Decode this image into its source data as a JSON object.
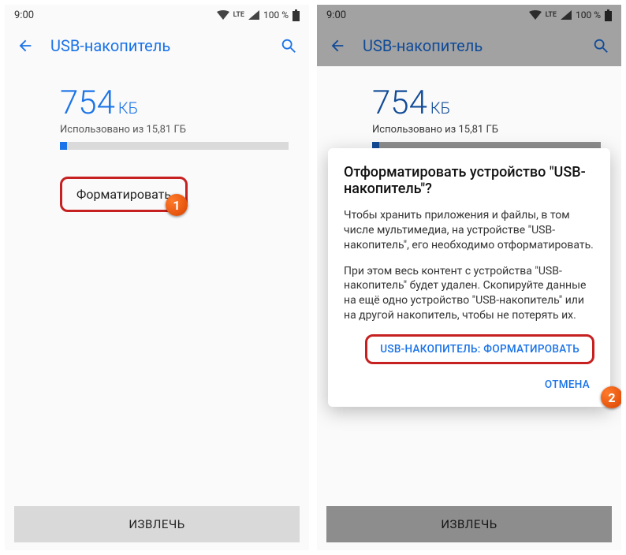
{
  "status": {
    "time": "9:00",
    "battery": "100 %",
    "network": "LTE"
  },
  "appbar": {
    "title": "USB-накопитель"
  },
  "storage": {
    "amount": "754",
    "unit": "КБ",
    "sub": "Использовано из 15,81 ГБ"
  },
  "format_label": "Форматировать",
  "eject_label": "ИЗВЛЕЧЬ",
  "dialog": {
    "title": "Отформатировать устройство \"USB-накопитель\"?",
    "p1": "Чтобы хранить приложения и файлы, в том числе мультимедиа, на устройстве \"USB-накопитель\", его необходимо отформатировать.",
    "p2": "При этом весь контент с устройства \"USB-накопитель\" будет удален. Скопируйте данные на ещё одно устройство \"USB-накопитель\" или на другой накопитель, чтобы не потерять их.",
    "confirm": "USB-НАКОПИТЕЛЬ: ФОРМАТИРОВАТЬ",
    "cancel": "ОТМЕНА"
  },
  "annotations": {
    "one": "1",
    "two": "2"
  }
}
